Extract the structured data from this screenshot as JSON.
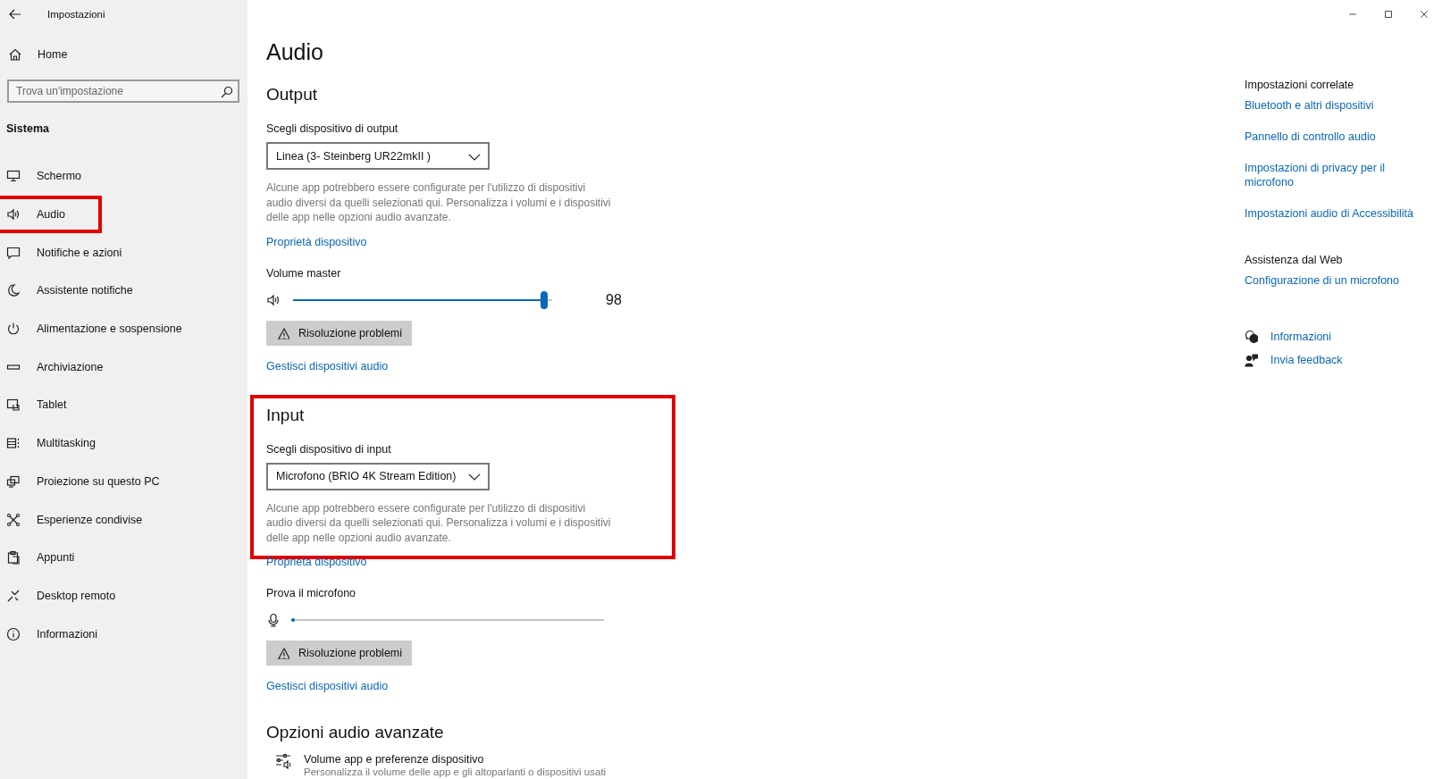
{
  "window": {
    "title": "Impostazioni"
  },
  "sidebar": {
    "home": "Home",
    "search": {
      "placeholder": "Trova un'impostazione"
    },
    "section": "Sistema",
    "items": [
      {
        "label": "Schermo",
        "highlighted": false
      },
      {
        "label": "Audio",
        "highlighted": true
      },
      {
        "label": "Notifiche e azioni",
        "highlighted": false
      },
      {
        "label": "Assistente notifiche",
        "highlighted": false
      },
      {
        "label": "Alimentazione e sospensione",
        "highlighted": false
      },
      {
        "label": "Archiviazione",
        "highlighted": false
      },
      {
        "label": "Tablet",
        "highlighted": false
      },
      {
        "label": "Multitasking",
        "highlighted": false
      },
      {
        "label": "Proiezione su questo PC",
        "highlighted": false
      },
      {
        "label": "Esperienze condivise",
        "highlighted": false
      },
      {
        "label": "Appunti",
        "highlighted": false
      },
      {
        "label": "Desktop remoto",
        "highlighted": false
      },
      {
        "label": "Informazioni",
        "highlighted": false
      }
    ]
  },
  "page": {
    "title": "Audio",
    "sections": [
      {
        "heading": "Output",
        "highlighted": false,
        "device_label": "Scegli dispositivo di output",
        "device": "Linea (3- Steinberg UR22mkII )",
        "note": "Alcune app potrebbero essere configurate per l'utilizzo di dispositivi audio diversi da quelli selezionati qui. Personalizza i volumi e i dispositivi delle app nelle opzioni audio avanzate.",
        "properties_link": "Proprietà dispositivo",
        "meter_label": "Volume master",
        "meter": {
          "kind": "slider",
          "level": 0.97,
          "reading": "98"
        },
        "troubleshoot": "Risoluzione problemi",
        "manage_link": "Gestisci dispositivi audio"
      },
      {
        "heading": "Input",
        "highlighted": true,
        "device_label": "Scegli dispositivo di input",
        "device": "Microfono (BRIO 4K Stream Edition)",
        "note": "Alcune app potrebbero essere configurate per l'utilizzo di dispositivi audio diversi da quelli selezionati qui. Personalizza i volumi e i dispositivi delle app nelle opzioni audio avanzate.",
        "properties_link": "Proprietà dispositivo",
        "meter_label": "Prova il microfono",
        "meter": {
          "kind": "meter",
          "level": 0.01
        },
        "troubleshoot": "Risoluzione problemi",
        "manage_link": "Gestisci dispositivi audio"
      }
    ],
    "advanced": {
      "heading": "Opzioni audio avanzate",
      "item": {
        "title": "Volume app e preferenze dispositivo",
        "description": "Personalizza il volume delle app e gli altoparlanti o dispositivi usati"
      }
    }
  },
  "related": {
    "groups": [
      {
        "heading": "Impostazioni correlate",
        "links": [
          "Bluetooth e altri dispositivi",
          "Pannello di controllo audio",
          "Impostazioni di privacy per il microfono",
          "Impostazioni audio di Accessibilità"
        ]
      },
      {
        "heading": "Assistenza dal Web",
        "links": [
          "Configurazione di un microfono"
        ]
      }
    ],
    "actions": [
      "Informazioni",
      "Invia feedback"
    ]
  }
}
